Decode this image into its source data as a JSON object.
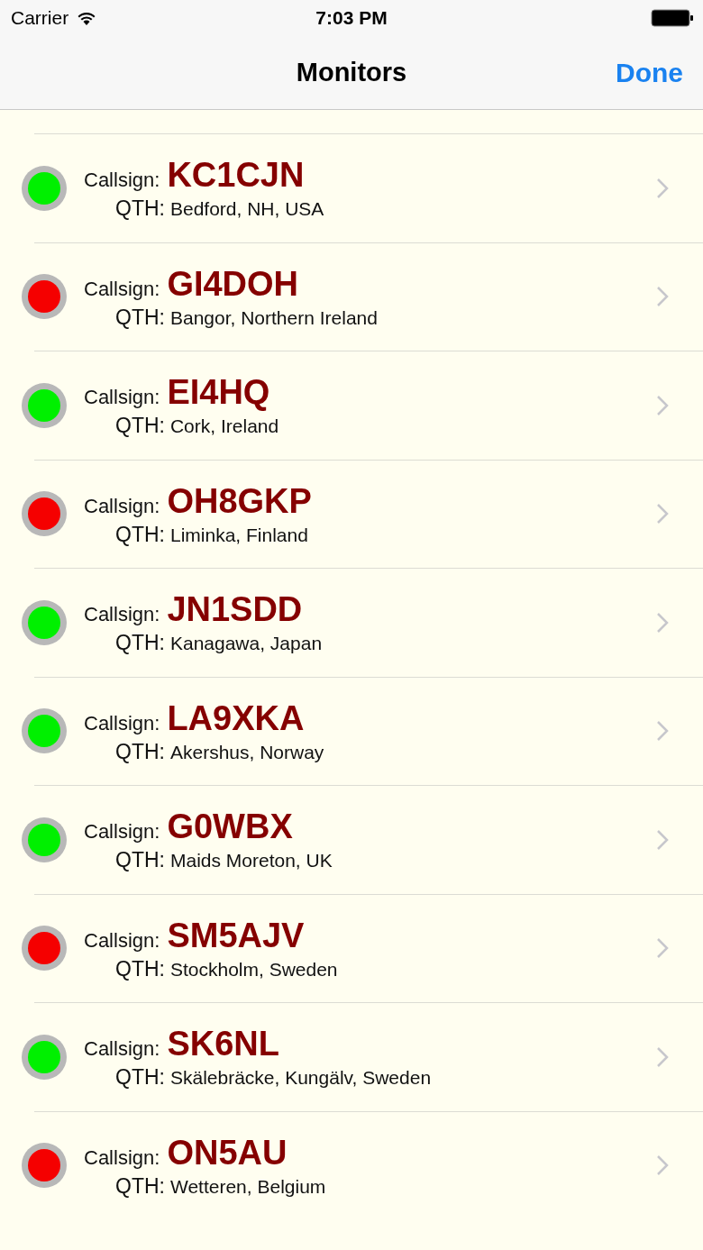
{
  "status_bar": {
    "carrier": "Carrier",
    "time": "7:03 PM"
  },
  "nav": {
    "title": "Monitors",
    "done": "Done"
  },
  "monitors": [
    {
      "label": "Callsign:",
      "callsign": "KC1CJN",
      "qth_label": "QTH:",
      "qth": "Bedford, NH, USA",
      "online": true
    },
    {
      "label": "Callsign:",
      "callsign": "GI4DOH",
      "qth_label": "QTH:",
      "qth": "Bangor, Northern Ireland",
      "online": false
    },
    {
      "label": "Callsign:",
      "callsign": "EI4HQ",
      "qth_label": "QTH:",
      "qth": "Cork, Ireland",
      "online": true
    },
    {
      "label": "Callsign:",
      "callsign": "OH8GKP",
      "qth_label": "QTH:",
      "qth": "Liminka, Finland",
      "online": false
    },
    {
      "label": "Callsign:",
      "callsign": "JN1SDD",
      "qth_label": "QTH:",
      "qth": "Kanagawa, Japan",
      "online": true
    },
    {
      "label": "Callsign:",
      "callsign": "LA9XKA",
      "qth_label": "QTH:",
      "qth": "Akershus, Norway",
      "online": true
    },
    {
      "label": "Callsign:",
      "callsign": "G0WBX",
      "qth_label": "QTH:",
      "qth": "Maids Moreton, UK",
      "online": true
    },
    {
      "label": "Callsign:",
      "callsign": "SM5AJV",
      "qth_label": "QTH:",
      "qth": "Stockholm, Sweden",
      "online": false
    },
    {
      "label": "Callsign:",
      "callsign": "SK6NL",
      "qth_label": "QTH:",
      "qth": "Skälebräcke, Kungälv, Sweden",
      "online": true
    },
    {
      "label": "Callsign:",
      "callsign": "ON5AU",
      "qth_label": "QTH:",
      "qth": "Wetteren, Belgium",
      "online": false
    }
  ]
}
